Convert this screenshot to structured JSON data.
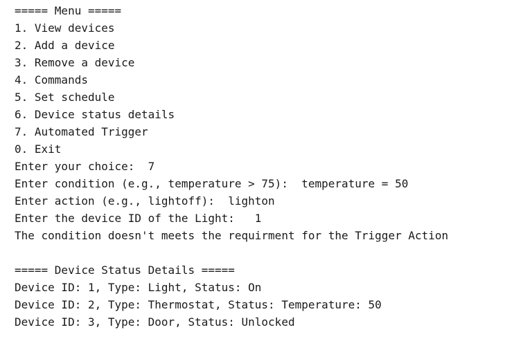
{
  "console": {
    "menu_header": "===== Menu =====",
    "menu_items": [
      "1. View devices",
      "2. Add a device",
      "3. Remove a device",
      "4. Commands",
      "5. Set schedule",
      "6. Device status details",
      "7. Automated Trigger",
      "0. Exit"
    ],
    "prompts": {
      "choice": "Enter your choice:  7",
      "condition": "Enter condition (e.g., temperature > 75):  temperature = 50",
      "action": "Enter action (e.g., lightoff):  lighton",
      "device_id": "Enter the device ID of the Light:   1"
    },
    "result_message": "The condition doesn't meets the requirment for the Trigger Action",
    "status_header": "===== Device Status Details =====",
    "devices": [
      "Device ID: 1, Type: Light, Status: On",
      "Device ID: 2, Type: Thermostat, Status: Temperature: 50",
      "Device ID: 3, Type: Door, Status: Unlocked"
    ]
  }
}
